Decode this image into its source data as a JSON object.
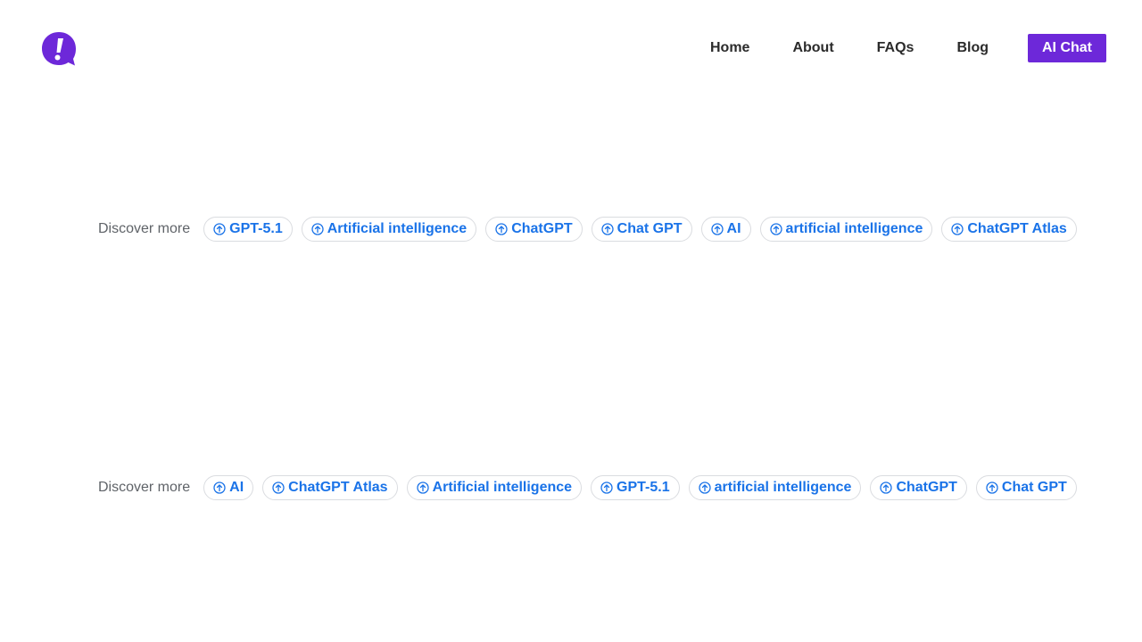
{
  "header": {
    "logo_icon": "exclamation-chat-bubble-icon",
    "nav": {
      "home": "Home",
      "about": "About",
      "faqs": "FAQs",
      "blog": "Blog",
      "cta": "AI Chat"
    }
  },
  "colors": {
    "brand": "#6d28d9",
    "chip_text": "#1a73e8",
    "chip_border": "#dadce0",
    "label_text": "#5f6368"
  },
  "discover_rows": [
    {
      "label": "Discover more",
      "chips": [
        "GPT-5.1",
        "Artificial intelligence",
        "ChatGPT",
        "Chat GPT",
        "AI",
        "artificial intelligence",
        "ChatGPT Atlas"
      ]
    },
    {
      "label": "Discover more",
      "chips": [
        "AI",
        "ChatGPT Atlas",
        "Artificial intelligence",
        "GPT-5.1",
        "artificial intelligence",
        "ChatGPT",
        "Chat GPT"
      ]
    }
  ],
  "chip_icon": "arrow-up-circle-icon"
}
